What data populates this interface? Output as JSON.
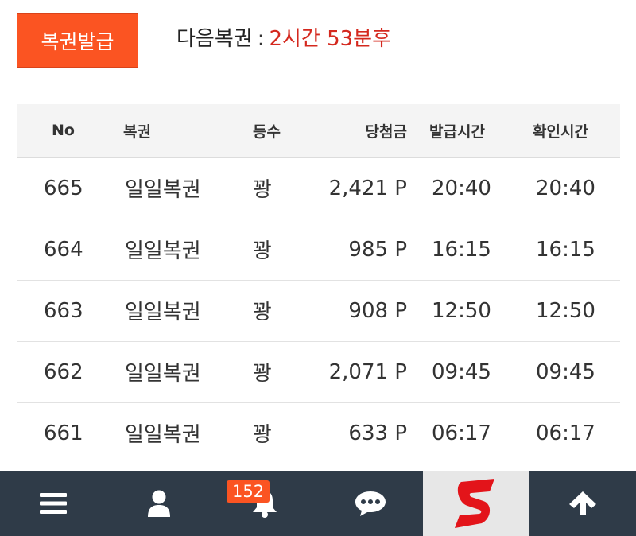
{
  "header": {
    "issue_button_label": "복권발급",
    "next_label": "다음복권",
    "next_colon": ":",
    "next_remaining": "2시간 53분후",
    "colors": {
      "accent": "#fb5422",
      "remaining_text": "#d4281e"
    }
  },
  "table": {
    "columns": [
      "No",
      "복권",
      "등수",
      "당첨금",
      "발급시간",
      "확인시간"
    ],
    "rows": [
      {
        "no": "665",
        "name": "일일복권",
        "rank": "꽝",
        "prize": "2,421 P",
        "issued": "20:40",
        "checked": "20:40"
      },
      {
        "no": "664",
        "name": "일일복권",
        "rank": "꽝",
        "prize": "985 P",
        "issued": "16:15",
        "checked": "16:15"
      },
      {
        "no": "663",
        "name": "일일복권",
        "rank": "꽝",
        "prize": "908 P",
        "issued": "12:50",
        "checked": "12:50"
      },
      {
        "no": "662",
        "name": "일일복권",
        "rank": "꽝",
        "prize": "2,071 P",
        "issued": "09:45",
        "checked": "09:45"
      },
      {
        "no": "661",
        "name": "일일복권",
        "rank": "꽝",
        "prize": "633 P",
        "issued": "06:17",
        "checked": "06:17"
      }
    ]
  },
  "bottom_nav": {
    "background": "#2f3b48",
    "items": [
      {
        "icon": "hamburger-menu-icon"
      },
      {
        "icon": "user-icon"
      },
      {
        "icon": "bell-icon",
        "badge": "152"
      },
      {
        "icon": "chat-bubble-icon"
      },
      {
        "icon": "s-logo-icon"
      },
      {
        "icon": "arrow-up-icon"
      }
    ]
  }
}
